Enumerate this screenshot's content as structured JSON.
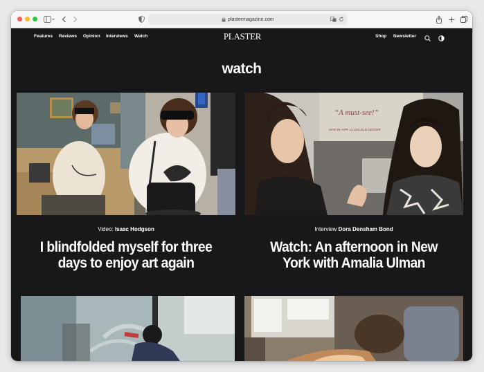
{
  "browser": {
    "url": "plastermagazine.com"
  },
  "site": {
    "logo": "PLASTER",
    "nav_left": [
      "Features",
      "Reviews",
      "Opinion",
      "Interviews",
      "Watch"
    ],
    "nav_right": [
      "Shop",
      "Newsletter"
    ]
  },
  "page": {
    "heading": "watch"
  },
  "articles": [
    {
      "kind": "Video:",
      "author": "Isaac Hodgson",
      "title_line1": "I blindfolded myself for three",
      "title_line2": "days to enjoy art again"
    },
    {
      "kind": "Interview",
      "author": "Dora Densham Bond",
      "title_line1": "Watch: An afternoon in New",
      "title_line2": "York with Amalia Ulman"
    }
  ],
  "photo_text": {
    "poster_quote": "“A must-see!”",
    "poster_dates": "MAR 26–APR 13  LINCOLN CENTER"
  },
  "colors": {
    "page_bg": "#18181b",
    "text": "#ffffff",
    "toolbar_bg": "#f6f6f6"
  },
  "icons": [
    "sidebar-icon",
    "chevron-left-icon",
    "chevron-right-icon",
    "shield-icon",
    "translate-icon",
    "reload-icon",
    "share-icon",
    "plus-icon",
    "tabs-icon",
    "search-icon",
    "contrast-icon"
  ]
}
